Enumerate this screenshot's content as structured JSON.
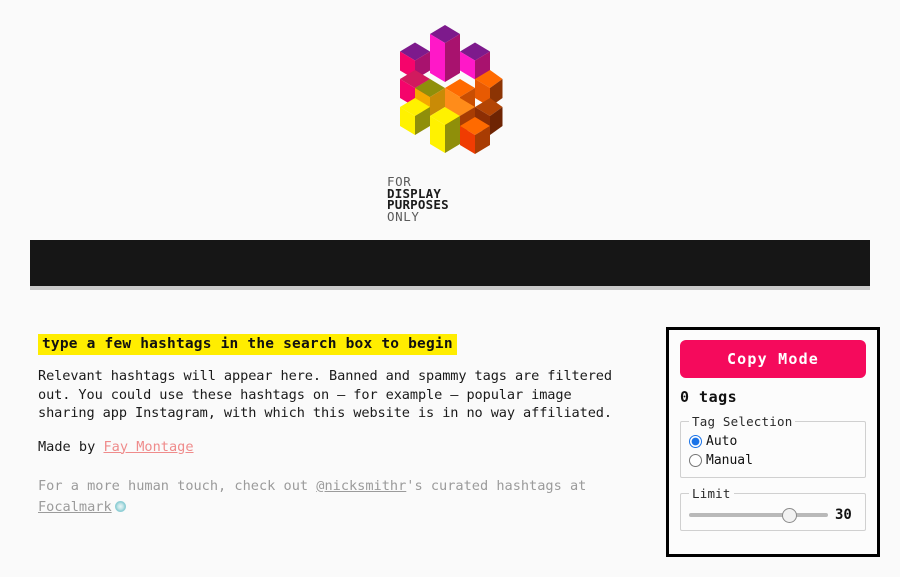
{
  "page": {
    "background_color": "#fafafa"
  },
  "logo": {
    "name": "for-display-purposes-only-logo",
    "wordmark": [
      {
        "text": "FOR",
        "weight": "light"
      },
      {
        "text": "DISPLAY",
        "weight": "bold"
      },
      {
        "text": "PURPOSES",
        "weight": "bold"
      },
      {
        "text": "ONLY",
        "weight": "light"
      }
    ],
    "colors": {
      "purple_top": "#7d1a8c",
      "magenta_left": "#ff18c8",
      "magenta_dark_right": "#a8126e",
      "pink": "#f5046b",
      "orange_top": "#ff6a00",
      "orange_left": "#f03c02",
      "brown_right": "#8c3404",
      "yellow": "#fff200",
      "olive": "#8f8f0a",
      "gold": "#f5a800"
    }
  },
  "search": {
    "value": "",
    "placeholder": "",
    "background_color": "#161616"
  },
  "main": {
    "hint": "type a few hashtags in the search box to begin",
    "hint_highlight_color": "#ffed00",
    "blurb": "Relevant hashtags will appear here. Banned and spammy tags are filtered\nout. You could use these hashtags on — for example — popular image\nsharing app Instagram, with which this website is in no way affiliated.",
    "made_by_prefix": "Made by ",
    "made_by_link": "Fay Montage",
    "made_by_link_color": "#ef8b8b",
    "human_note_part1": "For a more human touch, check out ",
    "human_note_handle": "@nicksmithr",
    "human_note_part2": "'s curated hashtags at ",
    "human_note_brand": "Focalmark",
    "focalmark_icon": "teal-dot-icon"
  },
  "panel": {
    "copy_mode_label": "Copy Mode",
    "copy_mode_color": "#f50a5c",
    "tag_count": "0 tags",
    "tag_selection": {
      "legend": "Tag Selection",
      "options": [
        {
          "label": "Auto",
          "selected": true
        },
        {
          "label": "Manual",
          "selected": false
        }
      ],
      "accent_color": "#1a73e8"
    },
    "limit": {
      "legend": "Limit",
      "value": "30",
      "min": "0",
      "max": "40"
    }
  }
}
